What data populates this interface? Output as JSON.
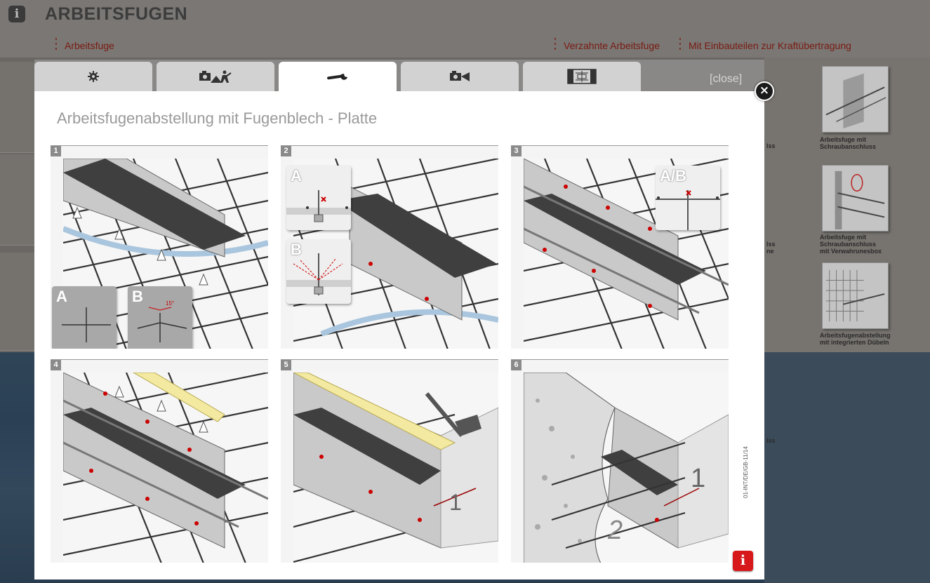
{
  "page": {
    "title": "ARBEITSFUGEN",
    "nav": [
      {
        "label": "Arbeitsfuge"
      },
      {
        "label": "Verzahnte Arbeitsfuge"
      },
      {
        "label": "Mit Einbauteilen zur Kraftübertragung"
      }
    ]
  },
  "side_items": [
    {
      "caption": "Arbeitsfuge mit\nSchraubanschluss"
    },
    {
      "caption": "Arbeitsfuge mit\nSchraubanschluss\nmit Verwahrunesbox"
    },
    {
      "caption": "Arbeitsfugenabstellung\nmit integrierten Dübeln"
    }
  ],
  "side_cut_texts": [
    "lss",
    "lss",
    "ne",
    "lss"
  ],
  "modal": {
    "tabs": [
      {
        "icon": "gear-icon",
        "active": false
      },
      {
        "icon": "camera-construction-icon",
        "active": false
      },
      {
        "icon": "wrench-icon",
        "active": true
      },
      {
        "icon": "video-camera-icon",
        "active": false
      },
      {
        "icon": "floorplan-icon",
        "active": false
      }
    ],
    "close_label": "[close]",
    "title": "Arbeitsfugenabstellung mit Fugenblech - Platte",
    "steps": [
      {
        "number": "1",
        "insets": [
          "A",
          "B"
        ],
        "angle_label": "15°"
      },
      {
        "number": "2",
        "insets": [
          "A",
          "B"
        ]
      },
      {
        "number": "3",
        "insets": [
          "A/B"
        ]
      },
      {
        "number": "4"
      },
      {
        "number": "5",
        "callout": "1"
      },
      {
        "number": "6",
        "callout": "1",
        "callout2": "2"
      }
    ],
    "doc_code": "01-INT/DE/GB-11/14"
  },
  "colors": {
    "accent_red": "#d7191c",
    "nav_red": "#7a1a12"
  }
}
